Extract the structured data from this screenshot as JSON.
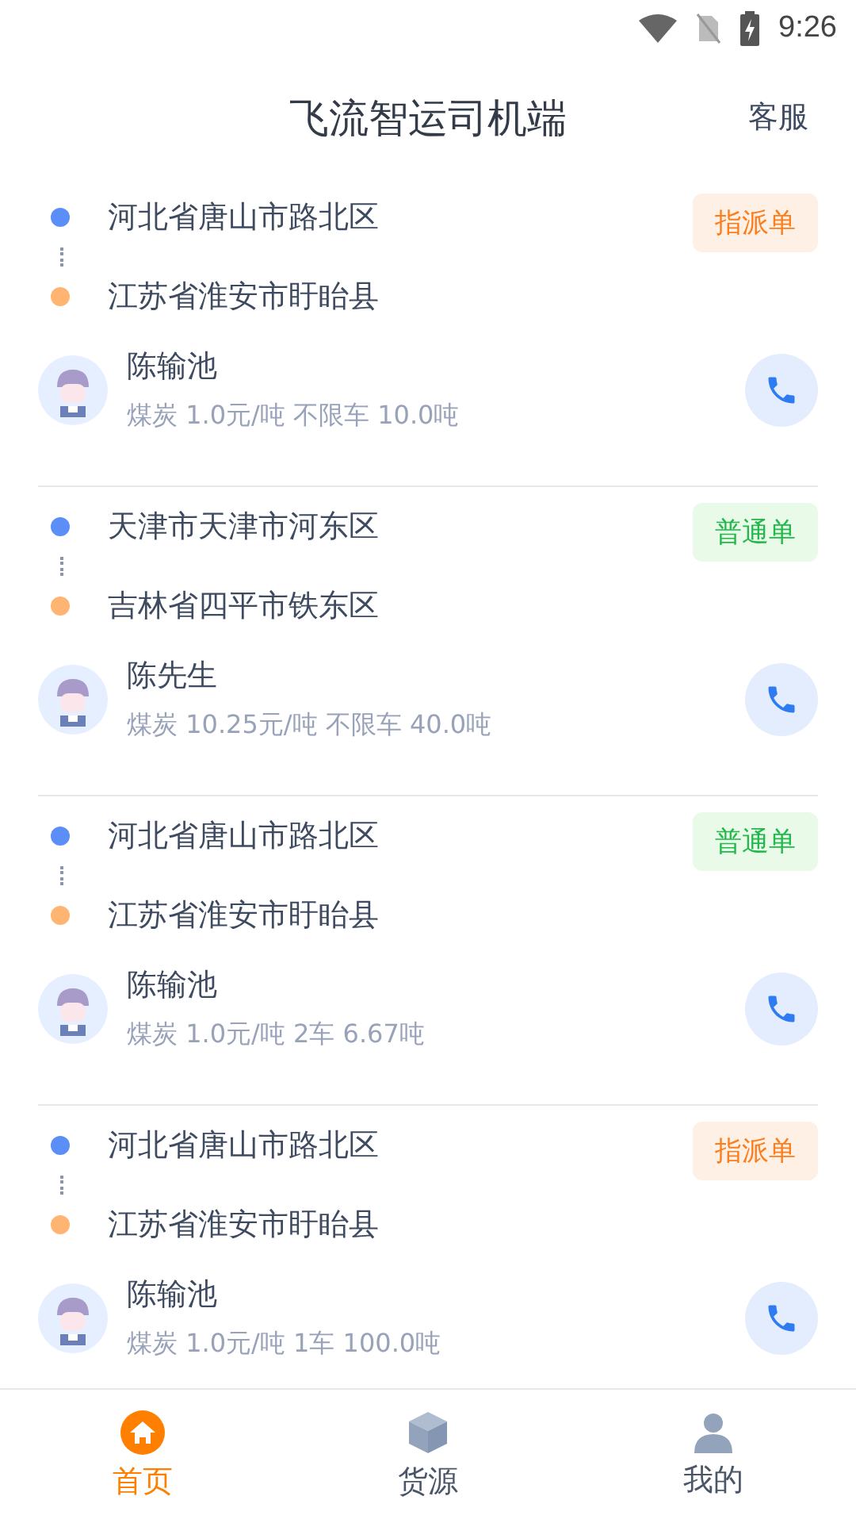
{
  "status_bar": {
    "time": "9:26"
  },
  "header": {
    "title": "飞流智运司机端",
    "action": "客服"
  },
  "orders": [
    {
      "origin": "河北省唐山市路北区",
      "destination": "江苏省淮安市盱眙县",
      "tag": {
        "label": "指派单",
        "kind": "assigned"
      },
      "contact": "陈输池",
      "detail": "煤炭 1.0元/吨 不限车 10.0吨"
    },
    {
      "origin": "天津市天津市河东区",
      "destination": "吉林省四平市铁东区",
      "tag": {
        "label": "普通单",
        "kind": "normal"
      },
      "contact": "陈先生",
      "detail": "煤炭 10.25元/吨 不限车 40.0吨"
    },
    {
      "origin": "河北省唐山市路北区",
      "destination": "江苏省淮安市盱眙县",
      "tag": {
        "label": "普通单",
        "kind": "normal"
      },
      "contact": "陈输池",
      "detail": "煤炭 1.0元/吨 2车 6.67吨"
    },
    {
      "origin": "河北省唐山市路北区",
      "destination": "江苏省淮安市盱眙县",
      "tag": {
        "label": "指派单",
        "kind": "assigned"
      },
      "contact": "陈输池",
      "detail": "煤炭 1.0元/吨 1车 100.0吨"
    }
  ],
  "tabs": [
    {
      "label": "首页",
      "kind": "home",
      "selected": true
    },
    {
      "label": "货源",
      "kind": "cargo",
      "selected": false
    },
    {
      "label": "我的",
      "kind": "profile",
      "selected": false
    }
  ]
}
